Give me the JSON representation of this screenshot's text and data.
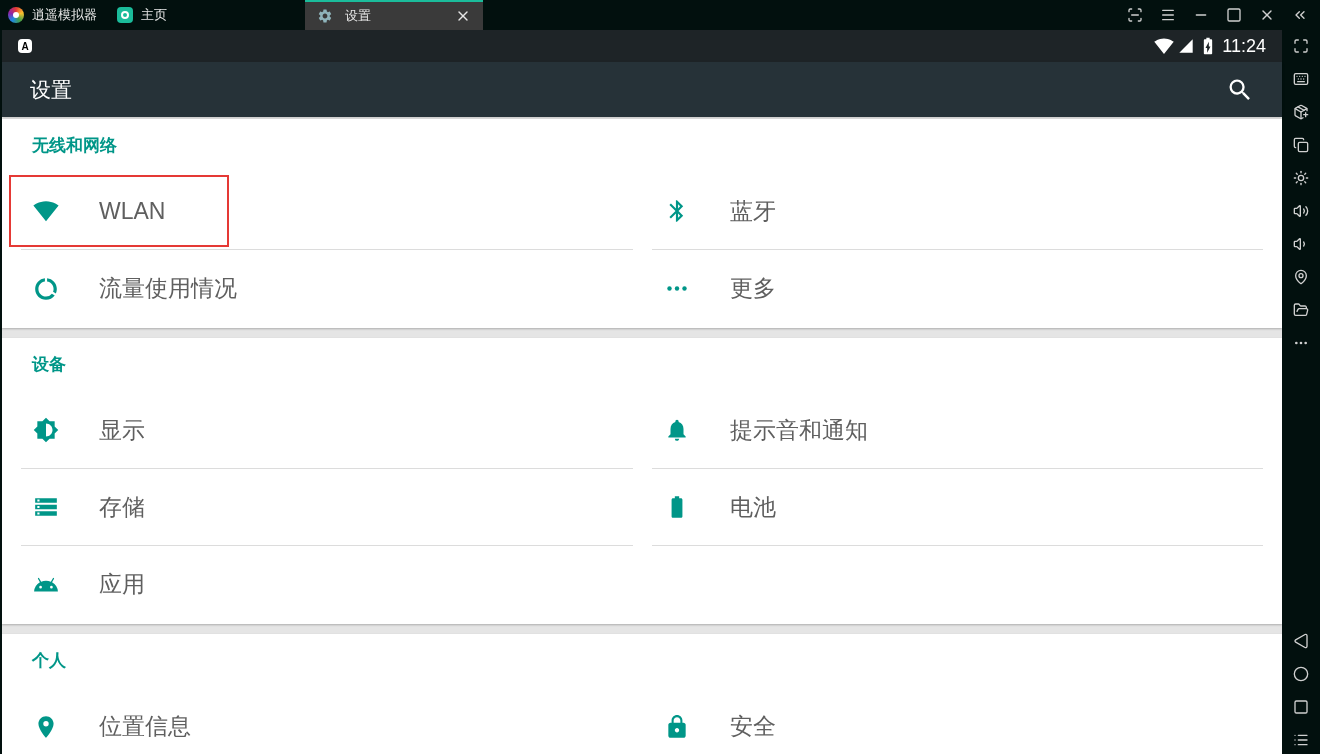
{
  "tabs": [
    {
      "label": "逍遥模拟器",
      "selected": false
    },
    {
      "label": "主页",
      "selected": false
    },
    {
      "label": "设置",
      "selected": true,
      "closable": true
    }
  ],
  "status_bar": {
    "notification": "A",
    "time": "11:24"
  },
  "toolbar": {
    "title": "设置"
  },
  "sections": [
    {
      "title": "无线和网络",
      "items": [
        {
          "label": "WLAN",
          "highlighted": true
        },
        {
          "label": "蓝牙",
          "highlighted": false
        },
        {
          "label": "流量使用情况",
          "highlighted": false
        },
        {
          "label": "更多",
          "highlighted": false
        }
      ]
    },
    {
      "title": "设备",
      "items": [
        {
          "label": "显示",
          "highlighted": false
        },
        {
          "label": "提示音和通知",
          "highlighted": false
        },
        {
          "label": "存储",
          "highlighted": false
        },
        {
          "label": "电池",
          "highlighted": false
        },
        {
          "label": "应用",
          "highlighted": false
        }
      ]
    },
    {
      "title": "个人",
      "items": [
        {
          "label": "位置信息",
          "highlighted": false
        },
        {
          "label": "安全",
          "highlighted": false
        }
      ]
    }
  ]
}
